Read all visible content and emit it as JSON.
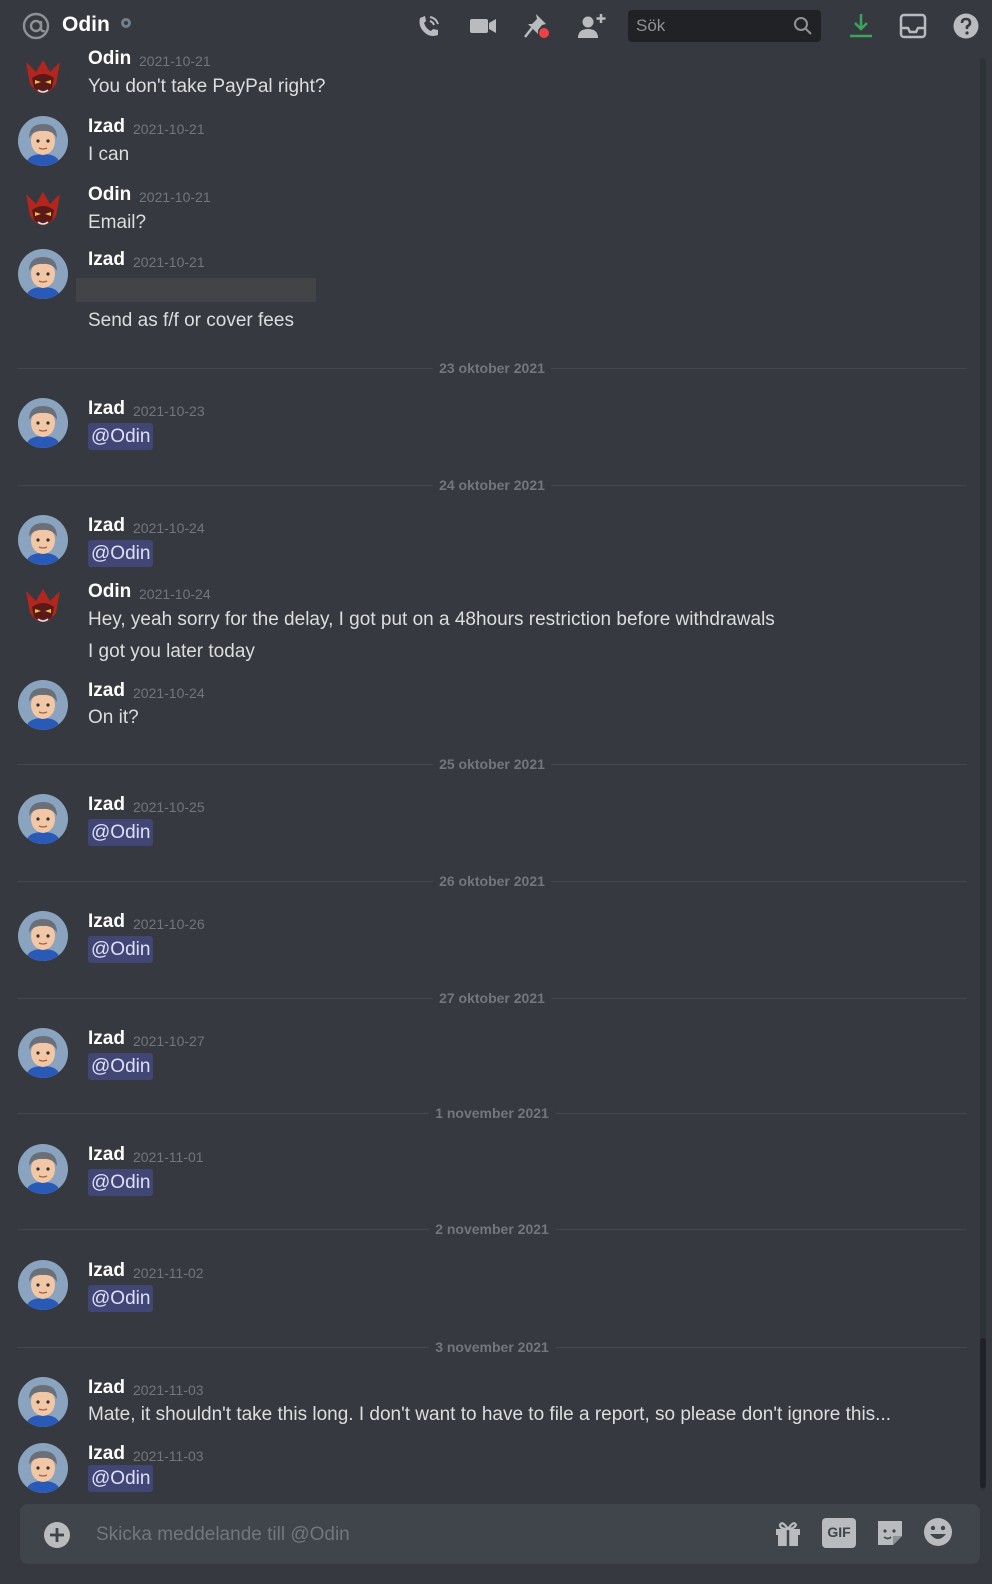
{
  "header": {
    "channel_name": "Odin",
    "search_placeholder": "Sök"
  },
  "messages": [
    {
      "author": "Odin",
      "timestamp": "2021-10-21",
      "text": "You don't take PayPal right?"
    },
    {
      "author": "Izad",
      "timestamp": "2021-10-21",
      "text": "I can"
    },
    {
      "author": "Odin",
      "timestamp": "2021-10-21",
      "text": "Email?"
    },
    {
      "author": "Izad",
      "timestamp": "2021-10-21",
      "text": "Send as f/f or cover fees"
    },
    {
      "author": "Izad",
      "timestamp": "2021-10-23",
      "text": "@Odin"
    },
    {
      "author": "Izad",
      "timestamp": "2021-10-24",
      "text": "@Odin"
    },
    {
      "author": "Odin",
      "timestamp": "2021-10-24",
      "text": "Hey, yeah sorry for the delay, I got put on a 48hours restriction before withdrawals",
      "text2": "I got you later today"
    },
    {
      "author": "Izad",
      "timestamp": "2021-10-24",
      "text": "On it?"
    },
    {
      "author": "Izad",
      "timestamp": "2021-10-25",
      "text": "@Odin"
    },
    {
      "author": "Izad",
      "timestamp": "2021-10-26",
      "text": "@Odin"
    },
    {
      "author": "Izad",
      "timestamp": "2021-10-27",
      "text": "@Odin"
    },
    {
      "author": "Izad",
      "timestamp": "2021-11-01",
      "text": "@Odin"
    },
    {
      "author": "Izad",
      "timestamp": "2021-11-02",
      "text": "@Odin"
    },
    {
      "author": "Izad",
      "timestamp": "2021-11-03",
      "text": "Mate, it shouldn't take this long. I don't want to have to file a report, so please don't ignore this..."
    },
    {
      "author": "Izad",
      "timestamp": "2021-11-03",
      "text": "@Odin"
    }
  ],
  "dividers": [
    "23 oktober 2021",
    "24 oktober 2021",
    "25 oktober 2021",
    "26 oktober 2021",
    "27 oktober 2021",
    "1 november 2021",
    "2 november 2021",
    "3 november 2021"
  ],
  "composer": {
    "placeholder": "Skicka meddelande till @Odin",
    "gif_label": "GIF"
  },
  "colors": {
    "background": "#36393f",
    "mention_bg": "#414675",
    "download_green": "#3ba55d",
    "notification_red": "#ed4245"
  }
}
